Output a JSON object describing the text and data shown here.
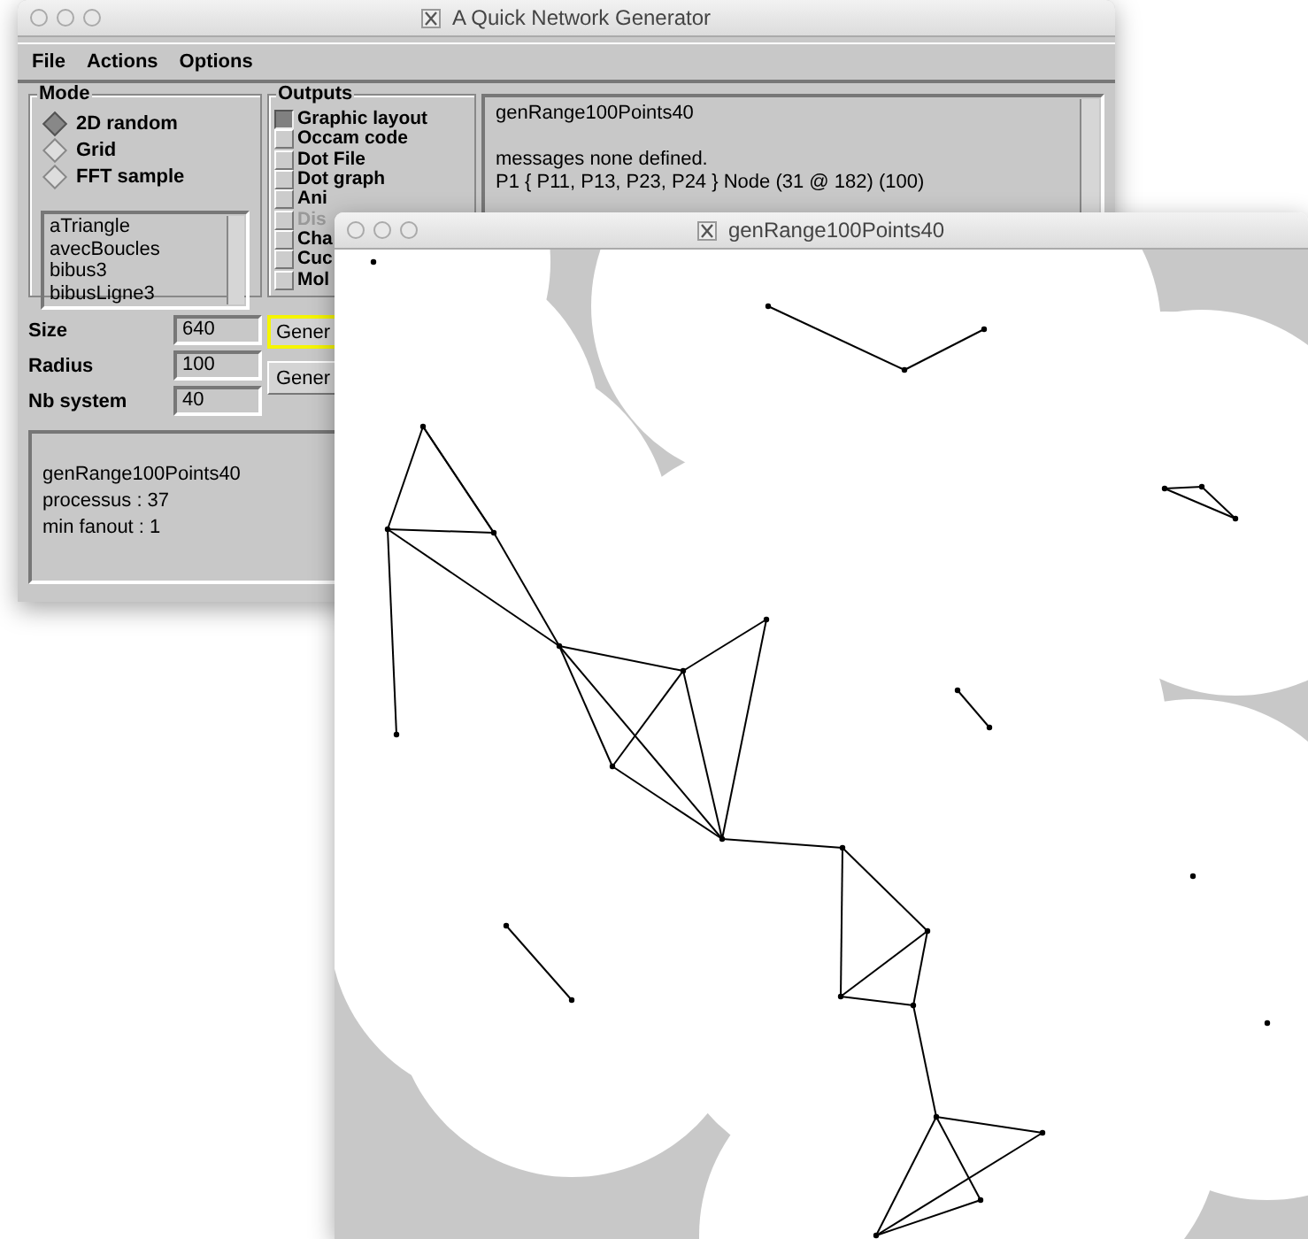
{
  "main_window": {
    "title": "A Quick Network Generator",
    "menu": [
      "File",
      "Actions",
      "Options"
    ],
    "mode": {
      "label": "Mode",
      "options": [
        {
          "label": "2D random",
          "selected": true
        },
        {
          "label": "Grid",
          "selected": false
        },
        {
          "label": "FFT sample",
          "selected": false
        }
      ]
    },
    "files": [
      "aTriangle",
      "avecBoucles",
      "bibus3",
      "bibusLigne3"
    ],
    "outputs": {
      "label": "Outputs",
      "items": [
        {
          "label": "Graphic layout",
          "checked": true,
          "disabled": false
        },
        {
          "label": "Occam code",
          "checked": false,
          "disabled": false
        },
        {
          "label": "Dot File",
          "checked": false,
          "disabled": false
        },
        {
          "label": "Dot graph",
          "checked": false,
          "disabled": false
        },
        {
          "label": "Ani",
          "checked": false,
          "disabled": false
        },
        {
          "label": "Dis",
          "checked": false,
          "disabled": true
        },
        {
          "label": "Cha",
          "checked": false,
          "disabled": false
        },
        {
          "label": "Cuc",
          "checked": false,
          "disabled": false
        },
        {
          "label": "Mol",
          "checked": false,
          "disabled": false
        }
      ]
    },
    "messages": [
      "genRange100Points40",
      "messages none  defined.",
      "P1 { P11, P13, P23, P24 } Node (31 @ 182) (100)"
    ],
    "fields": [
      {
        "label": "Size",
        "value": "640"
      },
      {
        "label": "Radius",
        "value": "100"
      },
      {
        "label": "Nb system",
        "value": "40"
      }
    ],
    "buttons": [
      {
        "label": "Gener",
        "focused": true
      },
      {
        "label": "Gener",
        "focused": false
      }
    ],
    "info": [
      "genRange100Points40",
      "processus : 37",
      "min fanout : 1"
    ]
  },
  "graph_window": {
    "title": "genRange100Points40"
  }
}
